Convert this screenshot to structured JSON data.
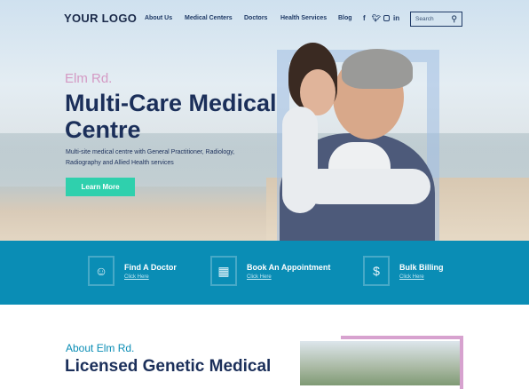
{
  "nav": {
    "logo": "YOUR LOGO",
    "links": [
      "About Us",
      "Medical Centers",
      "Doctors",
      "Health Services",
      "Blog"
    ],
    "social": [
      "f",
      "t",
      "ig",
      "in"
    ],
    "search_placeholder": "Search",
    "search_icon": "⚲"
  },
  "hero": {
    "subtitle": "Elm Rd.",
    "title": "Multi-Care Medical Centre",
    "description": "Multi-site medical centre with General Practitioner, Radiology, Radiography and Allied Health services",
    "button": "Learn More"
  },
  "features": [
    {
      "title": "Find A Doctor",
      "link": "Click Here",
      "icon": "doctor-icon"
    },
    {
      "title": "Book An Appointment",
      "link": "Click Here",
      "icon": "calendar-icon"
    },
    {
      "title": "Bulk Billing",
      "link": "Click Here",
      "icon": "bill-icon"
    }
  ],
  "about": {
    "subtitle": "About Elm Rd.",
    "title": "Licensed Genetic Medical"
  },
  "colors": {
    "primary": "#0a8db5",
    "accent": "#2fd0ad",
    "navy": "#1b2f5a",
    "pink": "#d49ac4"
  }
}
